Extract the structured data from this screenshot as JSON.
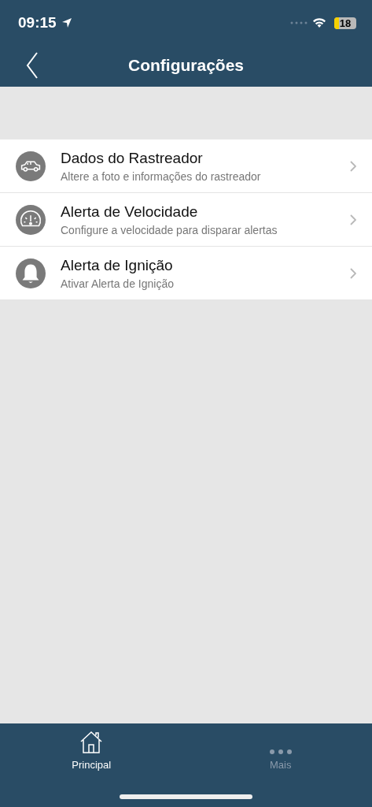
{
  "status_bar": {
    "time": "09:15",
    "battery": "18"
  },
  "nav": {
    "title": "Configurações"
  },
  "items": [
    {
      "kind": "car",
      "title": "Dados do Rastreador",
      "subtitle": "Altere a foto e informações do rastreador"
    },
    {
      "kind": "gauge",
      "title": "Alerta de Velocidade",
      "subtitle": "Configure a velocidade para disparar alertas"
    },
    {
      "kind": "bell",
      "title": "Alerta de Ignição",
      "subtitle": "Ativar Alerta de Ignição"
    }
  ],
  "tabs": [
    {
      "kind": "home",
      "label": "Principal",
      "selected": true
    },
    {
      "kind": "more",
      "label": "Mais",
      "selected": false
    }
  ]
}
